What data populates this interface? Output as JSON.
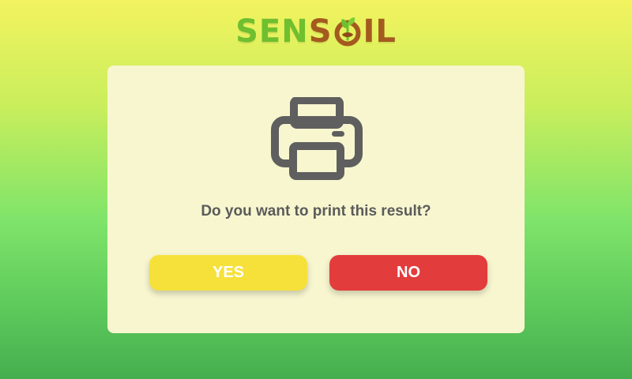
{
  "brand": {
    "part1": "SEN",
    "part2": "S",
    "part3": "IL"
  },
  "dialog": {
    "icon": "printer-icon",
    "question": "Do you want to print this result?",
    "yes_label": "YES",
    "no_label": "NO"
  },
  "colors": {
    "yes_button": "#f6e13a",
    "no_button": "#e33c3c",
    "dialog_bg": "#f7f6cf",
    "icon_color": "#5f5f5f",
    "brand_green": "#6fbf2f",
    "brand_brown": "#a45a1f"
  }
}
